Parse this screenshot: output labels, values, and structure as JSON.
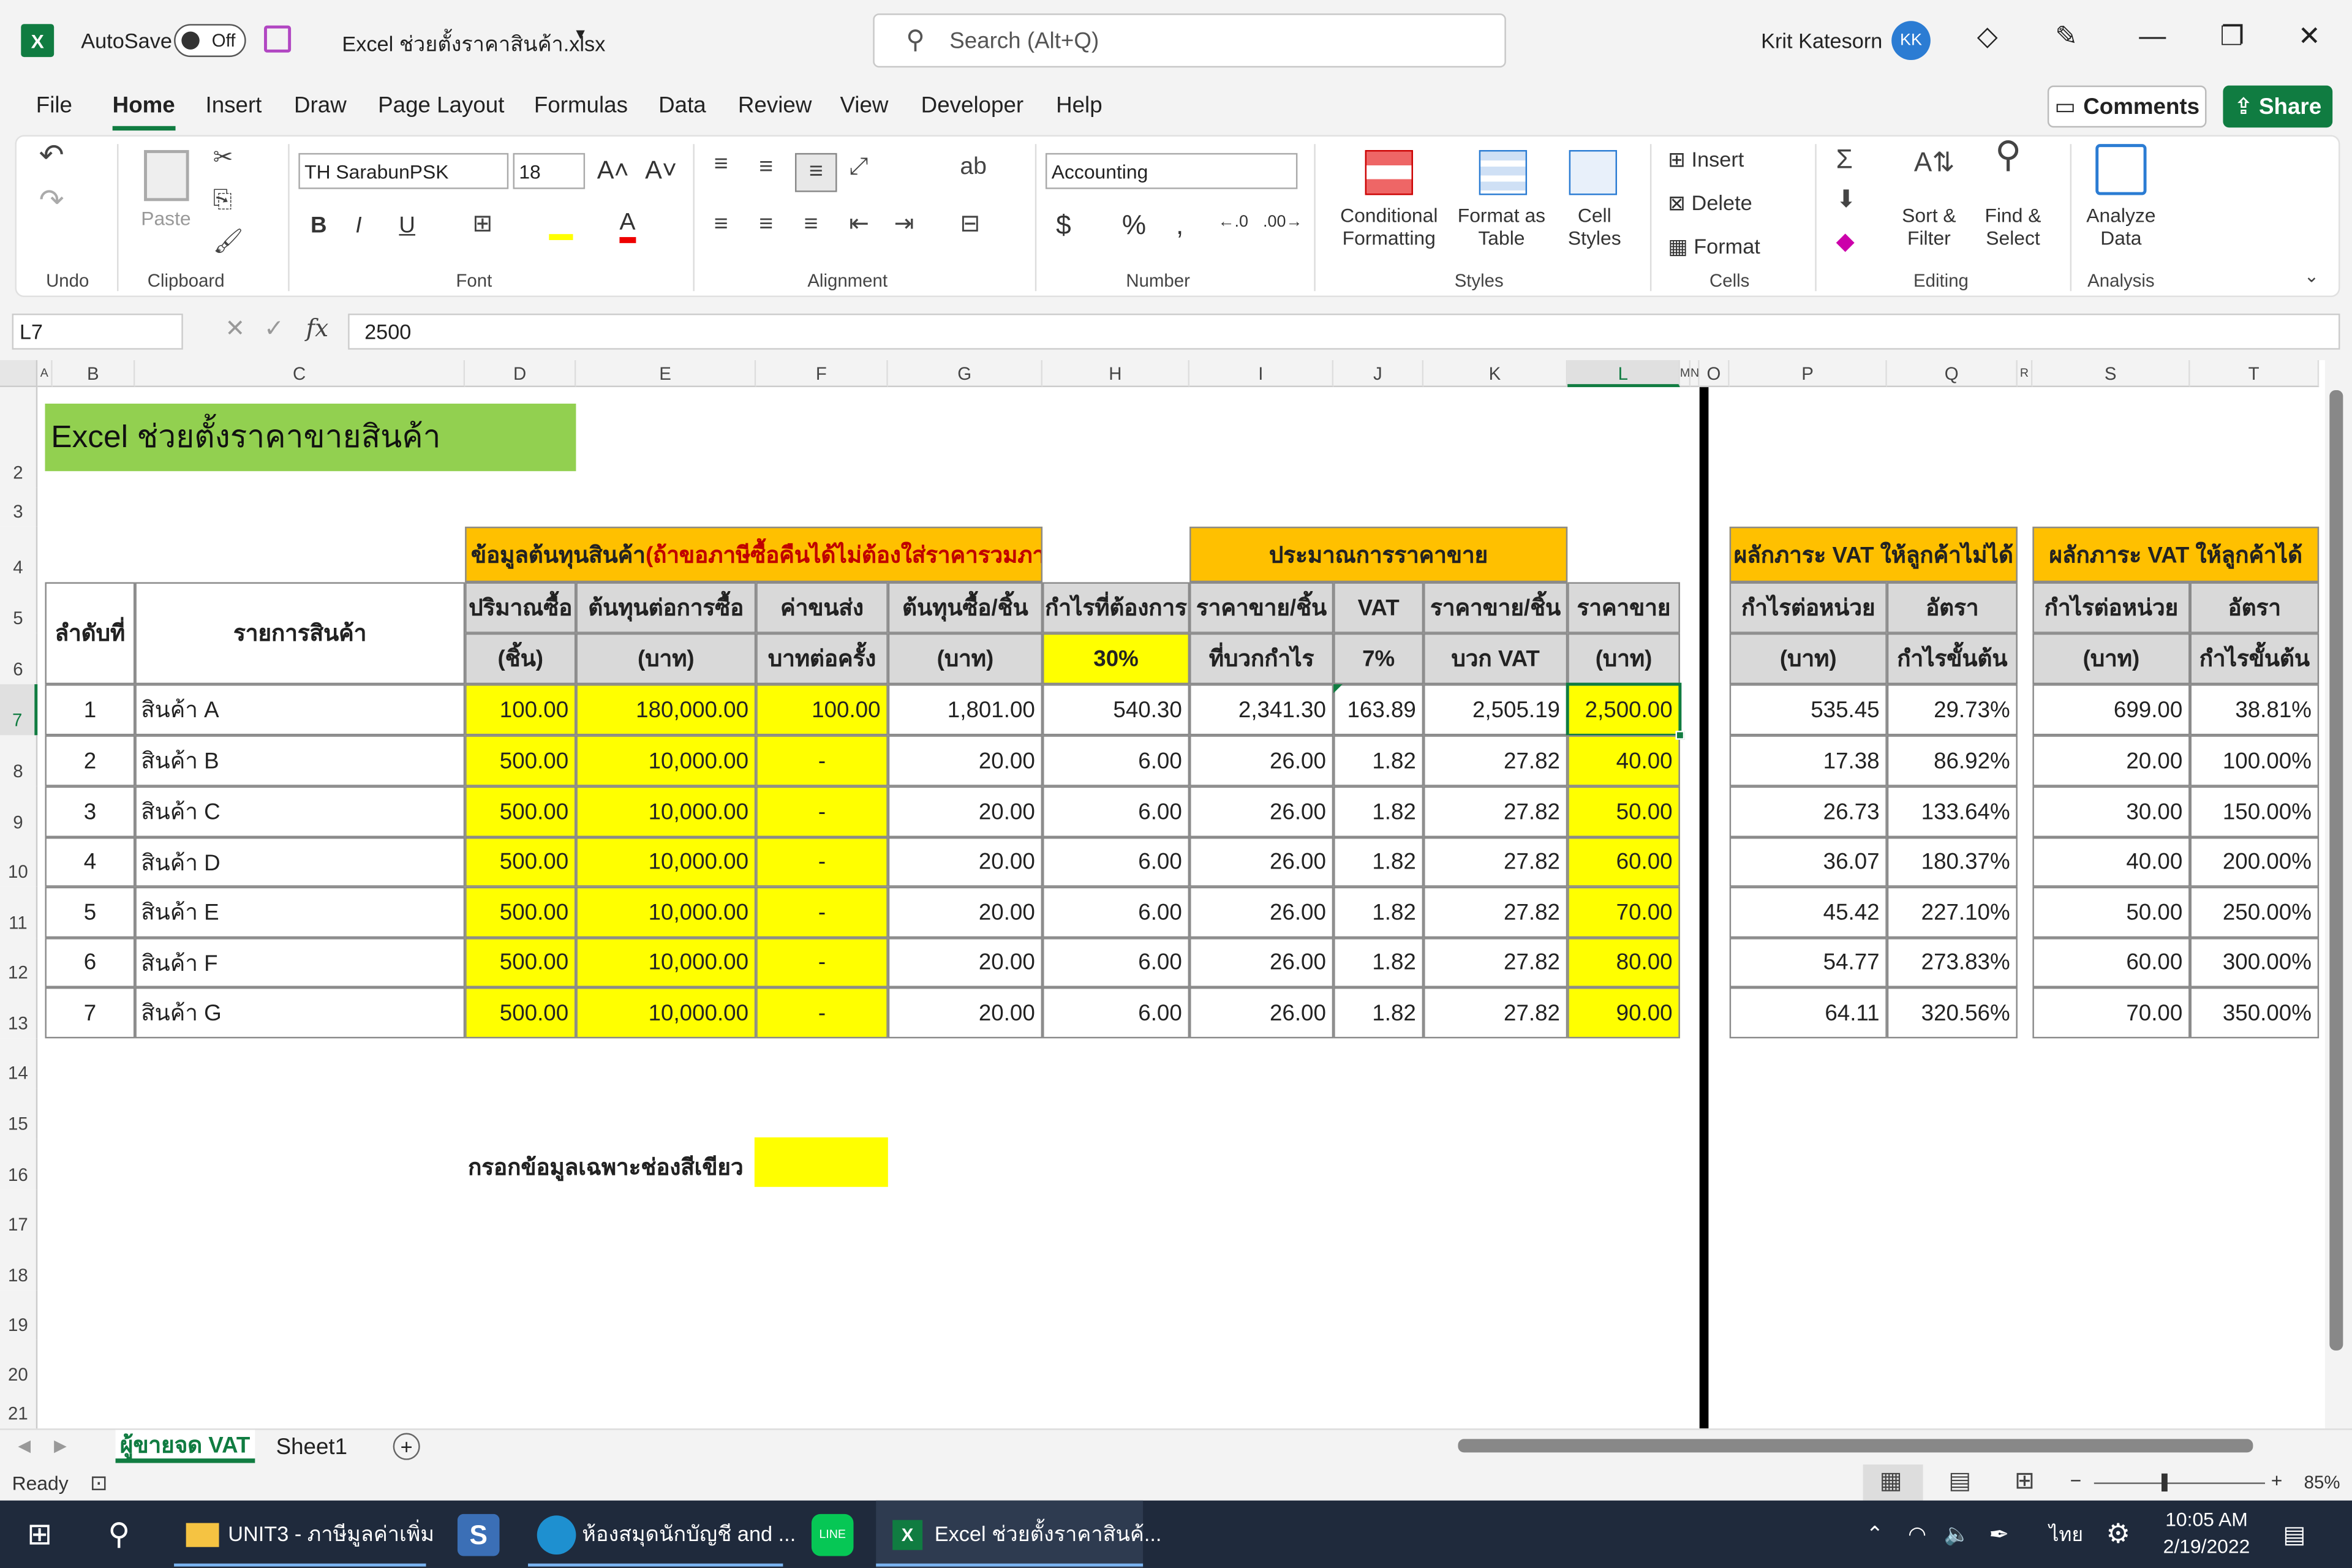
{
  "titlebar": {
    "autosave_label": "AutoSave",
    "autosave_state": "Off",
    "filename": "Excel ช่วยตั้งราคาสินค้า.xlsx",
    "search_placeholder": "Search (Alt+Q)",
    "user_name": "Krit Katesorn",
    "user_initials": "KK"
  },
  "menu": {
    "items": [
      "File",
      "Home",
      "Insert",
      "Draw",
      "Page Layout",
      "Formulas",
      "Data",
      "Review",
      "View",
      "Developer",
      "Help"
    ],
    "comments": "Comments",
    "share": "Share"
  },
  "ribbon": {
    "groups": {
      "undo": "Undo",
      "clipboard": "Clipboard",
      "font": "Font",
      "alignment": "Alignment",
      "number": "Number",
      "styles": "Styles",
      "cells": "Cells",
      "editing": "Editing",
      "analysis": "Analysis"
    },
    "paste": "Paste",
    "font_name": "TH SarabunPSK",
    "font_size": "18",
    "number_format": "Accounting",
    "cond_format_1": "Conditional",
    "cond_format_2": "Formatting",
    "format_table_1": "Format as",
    "format_table_2": "Table",
    "cell_styles_1": "Cell",
    "cell_styles_2": "Styles",
    "insert": "Insert",
    "delete": "Delete",
    "format": "Format",
    "sort_1": "Sort &",
    "sort_2": "Filter",
    "find_1": "Find &",
    "find_2": "Select",
    "analyze_1": "Analyze",
    "analyze_2": "Data"
  },
  "formula": {
    "namebox": "L7",
    "value": "2500"
  },
  "columns": [
    "A",
    "B",
    "C",
    "D",
    "E",
    "F",
    "G",
    "H",
    "I",
    "J",
    "K",
    "L",
    "M",
    "N",
    "O",
    "P",
    "Q",
    "R",
    "S",
    "T"
  ],
  "rows": [
    "2",
    "3",
    "4",
    "5",
    "6",
    "7",
    "8",
    "9",
    "10",
    "11",
    "12",
    "13",
    "14",
    "15",
    "16",
    "17",
    "18",
    "19",
    "20",
    "21"
  ],
  "sheet": {
    "title": "Excel ช่วยตั้งราคาขายสินค้า",
    "hdr_cost": "ข้อมูลต้นทุนสินค้า ",
    "hdr_cost_note": "(ถ้าขอภาษีซื้อคืนได้ไม่ต้องใส่ราคารวมภาษีซื้อ)",
    "hdr_estimate": "ประมาณการราคาขาย",
    "hdr_vat_no": "ผลักภาระ VAT ให้ลูกค้าไม่ได้",
    "hdr_vat_yes": "ผลักภาระ VAT ให้ลูกค้าได้",
    "h_no": "ลำดับที่",
    "h_item": "รายการสินค้า",
    "h_qty": "ปริมาณซื้อ",
    "h_qty2": "(ชิ้น)",
    "h_cost": "ต้นทุนต่อการซื้อ",
    "h_cost2": "(บาท)",
    "h_ship": "ค่าขนส่ง",
    "h_ship2": "บาทต่อครั้ง",
    "h_unit": "ต้นทุนซื้อ/ชิ้น",
    "h_unit2": "(บาท)",
    "h_profit": "กำไรที่ต้องการ",
    "h_profit2": "30%",
    "h_sp": "ราคาขาย/ชิ้น",
    "h_sp2": "ที่บวกกำไร",
    "h_vat": "VAT",
    "h_vat2": "7%",
    "h_spv": "ราคาขาย/ชิ้น",
    "h_spv2": "บวก VAT",
    "h_price": "ราคาขาย",
    "h_price2": "(บาท)",
    "h_pu": "กำไรต่อหน่วย",
    "h_pu2": "(บาท)",
    "h_rate": "อัตรา",
    "h_rate2": "กำไรขั้นต้น",
    "note": "กรอกข้อมูลเฉพาะช่องสีเขียว"
  },
  "table": [
    {
      "no": "1",
      "item": "สินค้า A",
      "qty": "100.00",
      "cost": "180,000.00",
      "ship": "100.00",
      "unit": "1,801.00",
      "profit": "540.30",
      "sp": "2,341.30",
      "vat": "163.89",
      "spv": "2,505.19",
      "price": "2,500.00",
      "pu1": "535.45",
      "r1": "29.73%",
      "pu2": "699.00",
      "r2": "38.81%"
    },
    {
      "no": "2",
      "item": "สินค้า B",
      "qty": "500.00",
      "cost": "10,000.00",
      "ship": "-",
      "unit": "20.00",
      "profit": "6.00",
      "sp": "26.00",
      "vat": "1.82",
      "spv": "27.82",
      "price": "40.00",
      "pu1": "17.38",
      "r1": "86.92%",
      "pu2": "20.00",
      "r2": "100.00%"
    },
    {
      "no": "3",
      "item": "สินค้า C",
      "qty": "500.00",
      "cost": "10,000.00",
      "ship": "-",
      "unit": "20.00",
      "profit": "6.00",
      "sp": "26.00",
      "vat": "1.82",
      "spv": "27.82",
      "price": "50.00",
      "pu1": "26.73",
      "r1": "133.64%",
      "pu2": "30.00",
      "r2": "150.00%"
    },
    {
      "no": "4",
      "item": "สินค้า D",
      "qty": "500.00",
      "cost": "10,000.00",
      "ship": "-",
      "unit": "20.00",
      "profit": "6.00",
      "sp": "26.00",
      "vat": "1.82",
      "spv": "27.82",
      "price": "60.00",
      "pu1": "36.07",
      "r1": "180.37%",
      "pu2": "40.00",
      "r2": "200.00%"
    },
    {
      "no": "5",
      "item": "สินค้า E",
      "qty": "500.00",
      "cost": "10,000.00",
      "ship": "-",
      "unit": "20.00",
      "profit": "6.00",
      "sp": "26.00",
      "vat": "1.82",
      "spv": "27.82",
      "price": "70.00",
      "pu1": "45.42",
      "r1": "227.10%",
      "pu2": "50.00",
      "r2": "250.00%"
    },
    {
      "no": "6",
      "item": "สินค้า F",
      "qty": "500.00",
      "cost": "10,000.00",
      "ship": "-",
      "unit": "20.00",
      "profit": "6.00",
      "sp": "26.00",
      "vat": "1.82",
      "spv": "27.82",
      "price": "80.00",
      "pu1": "54.77",
      "r1": "273.83%",
      "pu2": "60.00",
      "r2": "300.00%"
    },
    {
      "no": "7",
      "item": "สินค้า G",
      "qty": "500.00",
      "cost": "10,000.00",
      "ship": "-",
      "unit": "20.00",
      "profit": "6.00",
      "sp": "26.00",
      "vat": "1.82",
      "spv": "27.82",
      "price": "90.00",
      "pu1": "64.11",
      "r1": "320.56%",
      "pu2": "70.00",
      "r2": "350.00%"
    }
  ],
  "tabs": {
    "active": "ผู้ขายจด VAT",
    "other": "Sheet1"
  },
  "status": {
    "ready": "Ready",
    "zoom": "85%"
  },
  "taskbar": {
    "explorer": "UNIT3 - ภาษีมูลค่าเพิ่ม",
    "edge": "ห้องสมุดนักบัญชี and ...",
    "excel": "Excel ช่วยตั้งราคาสินค้...",
    "lang": "ไทย",
    "time": "10:05 AM",
    "date": "2/19/2022"
  },
  "colors": {
    "excel_green": "#107c41",
    "yellow": "#ffff00",
    "orange": "#ffc000",
    "title_green": "#92d050",
    "header_gray": "#d9d9d9"
  }
}
